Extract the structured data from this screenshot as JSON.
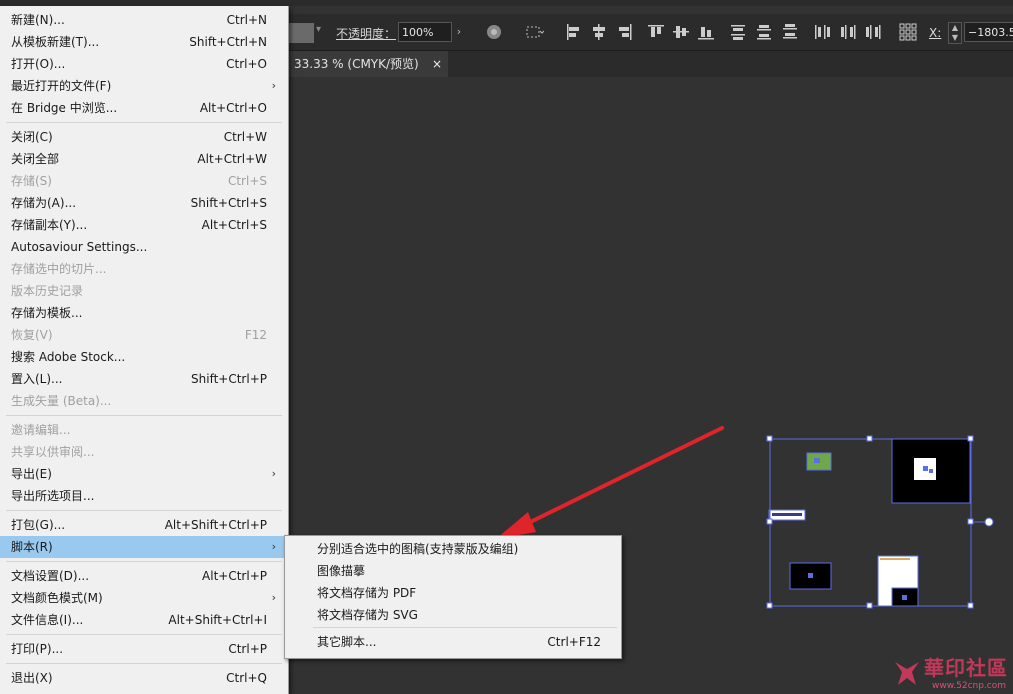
{
  "control_bar": {
    "opacity_label": "不透明度：",
    "opacity_value": "100%",
    "x_label": "X:",
    "x_value": "−1803.54"
  },
  "doc_tab": {
    "title": "33.33 % (CMYK/预览)",
    "close": "×"
  },
  "file_menu": [
    {
      "label": "新建(N)...",
      "shortcut": "Ctrl+N",
      "disabled": false
    },
    {
      "label": "从模板新建(T)...",
      "shortcut": "Shift+Ctrl+N",
      "disabled": false
    },
    {
      "label": "打开(O)...",
      "shortcut": "Ctrl+O",
      "disabled": false
    },
    {
      "label": "最近打开的文件(F)",
      "shortcut": "",
      "disabled": false,
      "submenu": true
    },
    {
      "label": "在 Bridge 中浏览...",
      "shortcut": "Alt+Ctrl+O",
      "disabled": false
    },
    {
      "label": "关闭(C)",
      "shortcut": "Ctrl+W",
      "disabled": false
    },
    {
      "label": "关闭全部",
      "shortcut": "Alt+Ctrl+W",
      "disabled": false
    },
    {
      "label": "存储(S)",
      "shortcut": "Ctrl+S",
      "disabled": true
    },
    {
      "label": "存储为(A)...",
      "shortcut": "Shift+Ctrl+S",
      "disabled": false
    },
    {
      "label": "存储副本(Y)...",
      "shortcut": "Alt+Ctrl+S",
      "disabled": false
    },
    {
      "label": "Autosaviour Settings...",
      "shortcut": "",
      "disabled": false
    },
    {
      "label": "存储选中的切片...",
      "shortcut": "",
      "disabled": true
    },
    {
      "label": "版本历史记录",
      "shortcut": "",
      "disabled": true
    },
    {
      "label": "存储为模板...",
      "shortcut": "",
      "disabled": false
    },
    {
      "label": "恢复(V)",
      "shortcut": "F12",
      "disabled": true
    },
    {
      "label": "搜索 Adobe Stock...",
      "shortcut": "",
      "disabled": false
    },
    {
      "label": "置入(L)...",
      "shortcut": "Shift+Ctrl+P",
      "disabled": false
    },
    {
      "label": "生成矢量 (Beta)...",
      "shortcut": "",
      "disabled": true
    },
    {
      "label": "邀请编辑...",
      "shortcut": "",
      "disabled": true
    },
    {
      "label": "共享以供审阅...",
      "shortcut": "",
      "disabled": true
    },
    {
      "label": "导出(E)",
      "shortcut": "",
      "disabled": false,
      "submenu": true
    },
    {
      "label": "导出所选项目...",
      "shortcut": "",
      "disabled": false
    },
    {
      "label": "打包(G)...",
      "shortcut": "Alt+Shift+Ctrl+P",
      "disabled": false
    },
    {
      "label": "脚本(R)",
      "shortcut": "",
      "disabled": false,
      "submenu": true,
      "highlighted": true
    },
    {
      "label": "文档设置(D)...",
      "shortcut": "Alt+Ctrl+P",
      "disabled": false
    },
    {
      "label": "文档颜色模式(M)",
      "shortcut": "",
      "disabled": false,
      "submenu": true
    },
    {
      "label": "文件信息(I)...",
      "shortcut": "Alt+Shift+Ctrl+I",
      "disabled": false
    },
    {
      "label": "打印(P)...",
      "shortcut": "Ctrl+P",
      "disabled": false
    },
    {
      "label": "退出(X)",
      "shortcut": "Ctrl+Q",
      "disabled": false
    }
  ],
  "scripts_submenu": [
    {
      "label": "分别适合选中的图稿(支持蒙版及编组)",
      "shortcut": ""
    },
    {
      "label": "图像描摹",
      "shortcut": ""
    },
    {
      "label": "将文档存储为 PDF",
      "shortcut": ""
    },
    {
      "label": "将文档存储为 SVG",
      "shortcut": ""
    },
    {
      "label": "其它脚本...",
      "shortcut": "Ctrl+F12"
    }
  ],
  "submenu_arrow": "›",
  "watermark": {
    "text": "華印社區",
    "url": "www.52cnp.com"
  },
  "colors": {
    "menu_bg": "#f0f0f0",
    "highlight": "#99c9ef",
    "canvas": "#323232",
    "arrow": "#e0242c",
    "selection": "#5b6ee8"
  }
}
